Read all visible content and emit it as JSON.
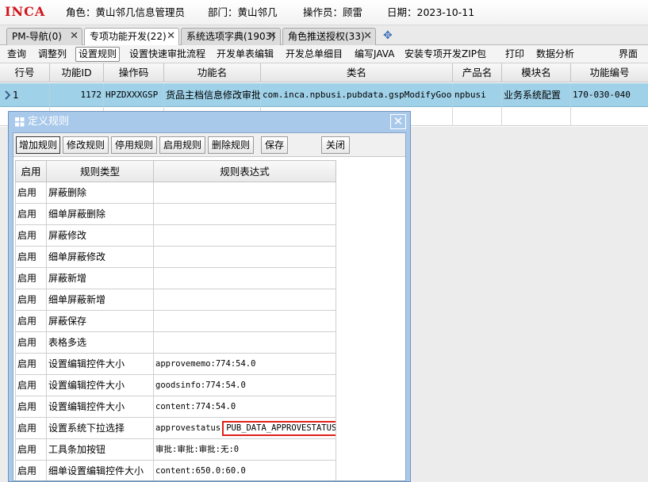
{
  "header": {
    "logo": "INCA",
    "role": "角色：黄山邻几信息管理员",
    "dept": "部门：黄山邻几",
    "operator": "操作员：顾雷",
    "date": "日期：2023-10-11"
  },
  "tabs": [
    {
      "label": "PM-导航(0)",
      "active": false
    },
    {
      "label": "专项功能开发(22)",
      "active": true
    },
    {
      "label": "系统选项字典(1903)",
      "active": false
    },
    {
      "label": "角色推送授权(33)",
      "active": false
    }
  ],
  "toolbar": {
    "items": [
      "查询",
      "调整列",
      "设置规则",
      "设置快速审批流程",
      "开发单表编辑",
      "开发总单细目",
      "编写JAVA",
      "安装专项开发ZIP包",
      "打印",
      "数据分析",
      "界面"
    ]
  },
  "grid": {
    "columns": [
      "行号",
      "功能ID",
      "操作码",
      "功能名",
      "类名",
      "产品名",
      "模块名",
      "功能编号"
    ],
    "rows": [
      [
        "1",
        "1172",
        "HPZDXXXGSP",
        "货品主档信息修改审批",
        "com.inca.npbusi.pubdata.gspModifyGoo...",
        "npbusi",
        "业务系统配置",
        "170-030-040"
      ]
    ]
  },
  "dialog": {
    "title": "定义规则",
    "close_glyph": "✕",
    "buttons": [
      "增加规则",
      "修改规则",
      "停用规则",
      "启用规则",
      "删除规则",
      "保存",
      "关闭"
    ],
    "columns": [
      "启用",
      "规则类型",
      "规则表达式"
    ],
    "rows": [
      {
        "enabled": "启用",
        "type": "屏蔽删除",
        "expr": "",
        "expr_highlight": ""
      },
      {
        "enabled": "启用",
        "type": "细单屏蔽删除",
        "expr": "",
        "expr_highlight": ""
      },
      {
        "enabled": "启用",
        "type": "屏蔽修改",
        "expr": "",
        "expr_highlight": ""
      },
      {
        "enabled": "启用",
        "type": "细单屏蔽修改",
        "expr": "",
        "expr_highlight": ""
      },
      {
        "enabled": "启用",
        "type": "屏蔽新增",
        "expr": "",
        "expr_highlight": ""
      },
      {
        "enabled": "启用",
        "type": "细单屏蔽新增",
        "expr": "",
        "expr_highlight": ""
      },
      {
        "enabled": "启用",
        "type": "屏蔽保存",
        "expr": "",
        "expr_highlight": ""
      },
      {
        "enabled": "启用",
        "type": "表格多选",
        "expr": "",
        "expr_highlight": ""
      },
      {
        "enabled": "启用",
        "type": "设置编辑控件大小",
        "expr": "approvememo:774:54.0",
        "expr_highlight": ""
      },
      {
        "enabled": "启用",
        "type": "设置编辑控件大小",
        "expr": "goodsinfo:774:54.0",
        "expr_highlight": ""
      },
      {
        "enabled": "启用",
        "type": "设置编辑控件大小",
        "expr": "content:774:54.0",
        "expr_highlight": ""
      },
      {
        "enabled": "启用",
        "type": "设置系统下拉选择",
        "expr": "approvestatus",
        "expr_highlight": "PUB_DATA_APPROVESTATUS"
      },
      {
        "enabled": "启用",
        "type": "工具条加按钮",
        "expr": "审批:审批:审批:无:0",
        "expr_highlight": ""
      },
      {
        "enabled": "启用",
        "type": "细单设置编辑控件大小",
        "expr": "content:650.0:60.0",
        "expr_highlight": ""
      }
    ]
  },
  "colors": {
    "logo_red": "#d2141d",
    "selected_row": "#9fd1e8",
    "dialog_frame": "#a9c9eb",
    "highlight_box": "#e0201a"
  },
  "icons": {
    "tab_close": "close-icon",
    "new_tab": "plus-icon",
    "row_marker": "row-pointer-icon",
    "dialog_icon": "windows-icon"
  }
}
